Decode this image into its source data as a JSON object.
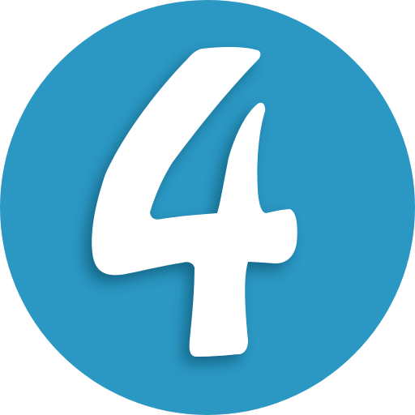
{
  "badge": {
    "digit": "4",
    "icon_name": "number-four-badge-icon",
    "circle_color": "#2B98C4",
    "digit_color": "#FFFFFF",
    "shadow_color": "#0C3E55"
  }
}
